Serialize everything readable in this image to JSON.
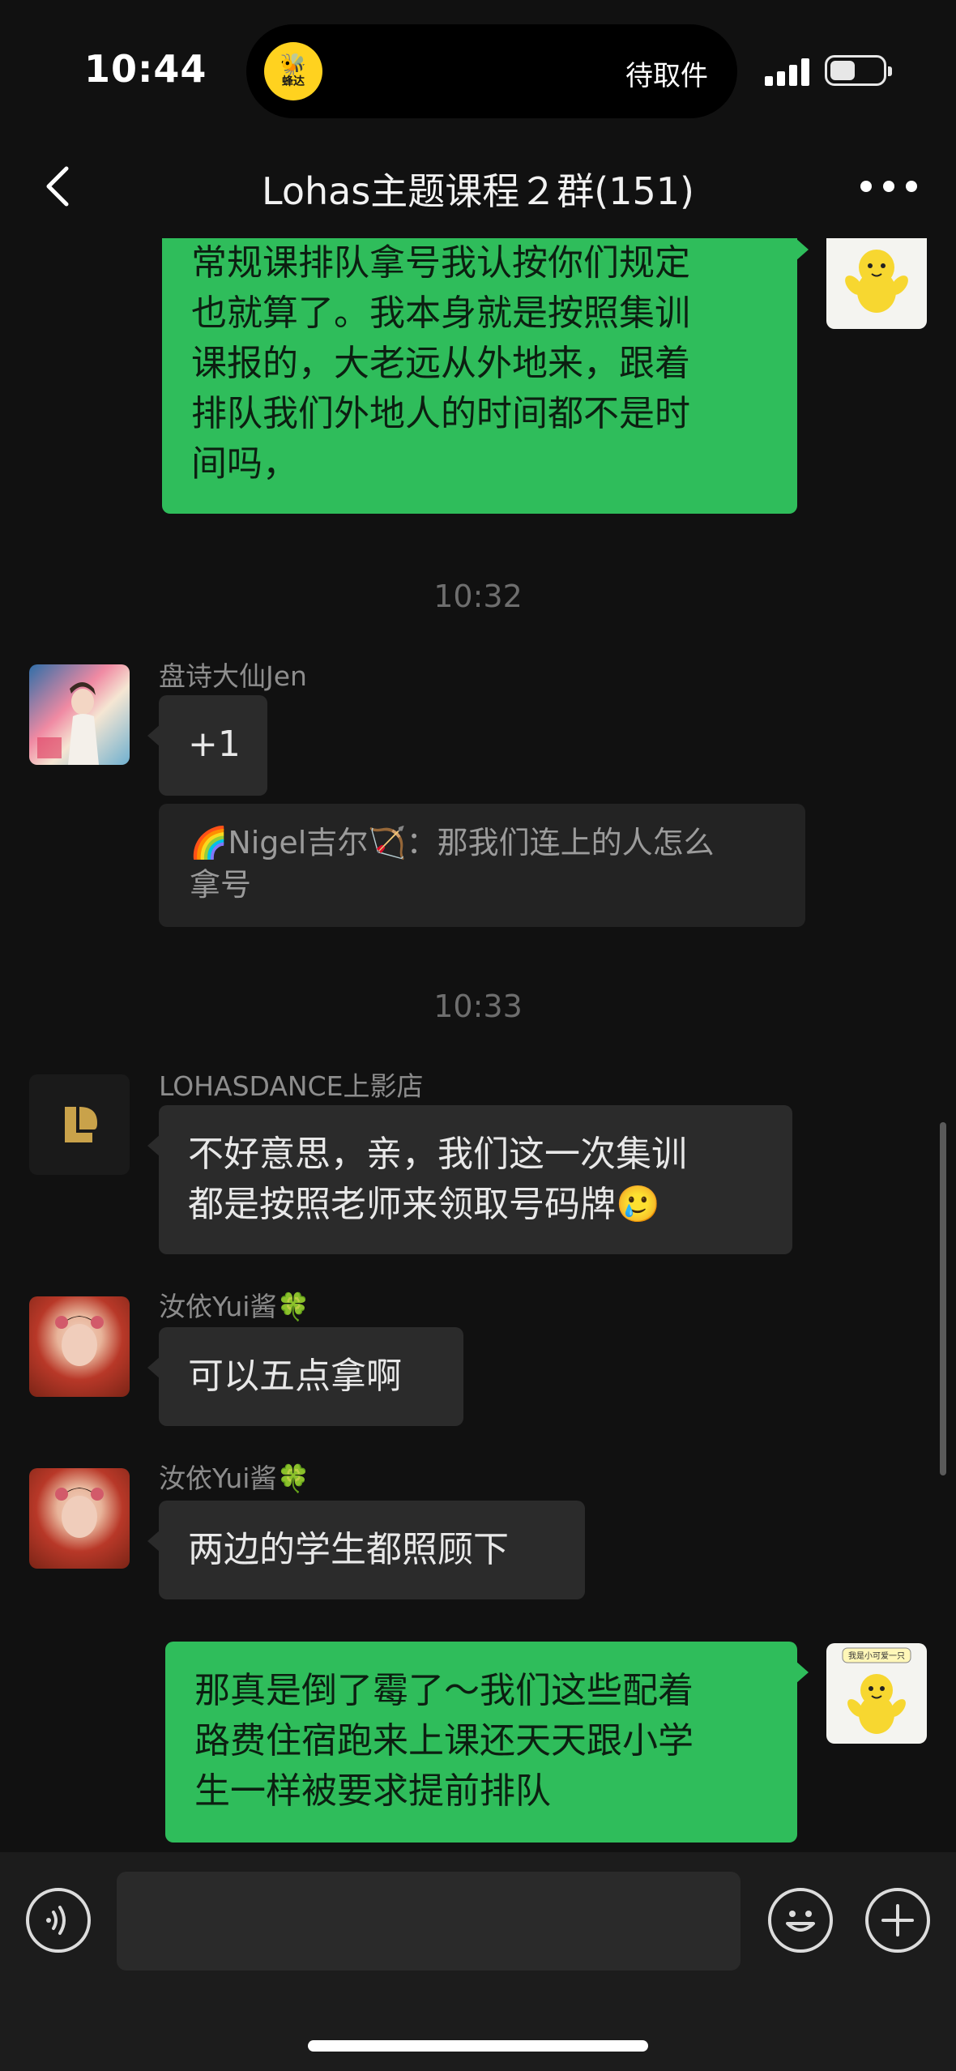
{
  "status_bar": {
    "time": "10:44",
    "island_app_label": "蜂达",
    "island_text": "待取件"
  },
  "nav": {
    "title": "Lohas主题课程２群(151)"
  },
  "messages": {
    "m1": {
      "lines": [
        "常规课排队拿号我认按你们规定",
        "也就算了。我本身就是按照集训",
        "课报的，大老远从外地来，跟着",
        "排队我们外地人的时间都不是时",
        "间吗，"
      ]
    },
    "t1": "10:32",
    "m2": {
      "sender": "盘诗大仙Jen",
      "text": "+1",
      "quote_lines": [
        "🌈Nigel吉尔🏹：那我们连上的人怎么",
        "拿号"
      ]
    },
    "t2": "10:33",
    "m3": {
      "sender": "LOHASDANCE上影店",
      "lines": [
        "不好意思，亲，我们这一次集训",
        "都是按照老师来领取号码牌🥲"
      ]
    },
    "m4": {
      "sender": "汝依Yui酱🍀",
      "text": "可以五点拿啊"
    },
    "m5": {
      "sender": "汝依Yui酱🍀",
      "text": "两边的学生都照顾下"
    },
    "m6": {
      "lines": [
        "那真是倒了霉了～我们这些配着",
        "路费住宿跑来上课还天天跟小学",
        "生一样被要求提前排队"
      ]
    },
    "sticker_label": "我是小可爱一只"
  },
  "colors": {
    "my_bubble": "#2fbd5b",
    "other_bubble": "#2b2b2b",
    "background": "#111111"
  }
}
